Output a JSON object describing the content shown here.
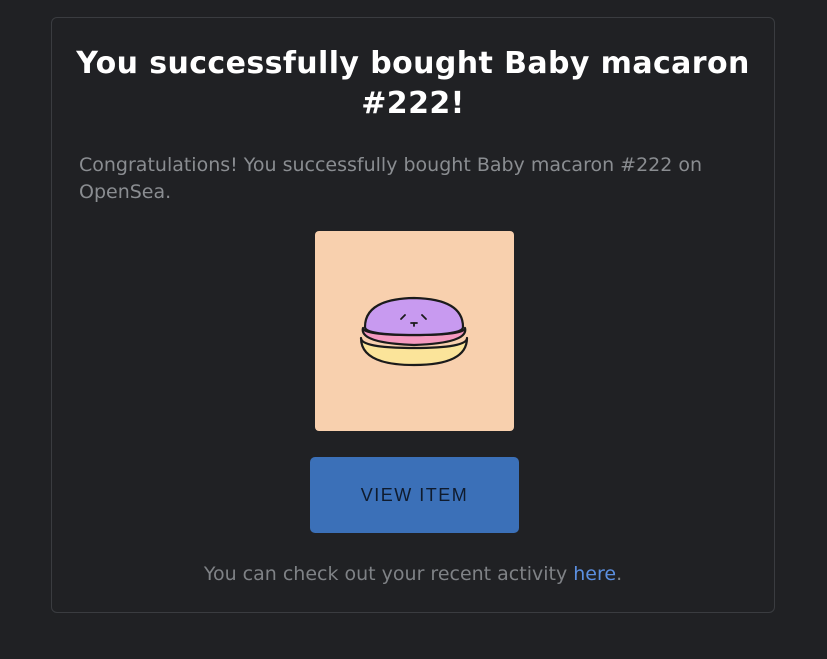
{
  "dialog": {
    "title": "You successfully bought Baby macaron #222!",
    "message": "Congratulations! You successfully bought Baby macaron #222 on OpenSea.",
    "button_label": "VIEW ITEM",
    "footer_text": "You can check out your recent activity ",
    "footer_link": "here",
    "footer_end": "."
  },
  "item": {
    "icon": "macaron-image",
    "background_color": "#f8d0ae"
  },
  "colors": {
    "page_background": "#202124",
    "button": "#3b70b8",
    "link": "#5b8fe0"
  }
}
